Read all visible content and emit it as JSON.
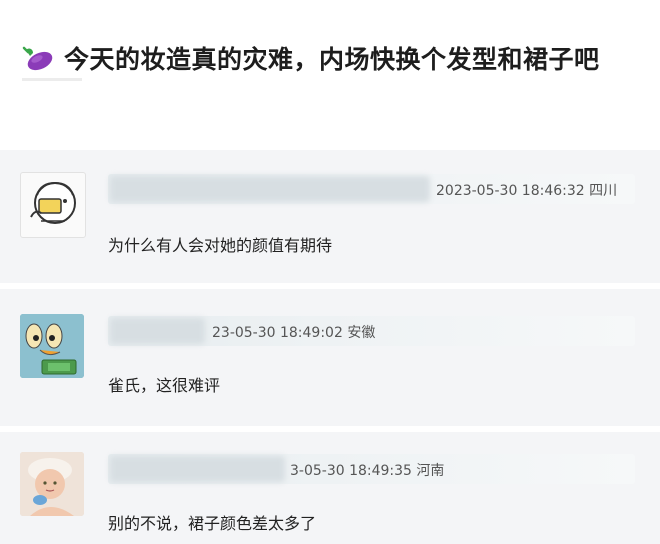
{
  "post": {
    "title": "今天的妆造真的灾难，内场快换个发型和裙子吧",
    "icon": "eggplant-icon"
  },
  "comments": [
    {
      "time_location": "2023-05-30 18:46:32 四川",
      "text": "为什么有人会对她的颜值有期待",
      "avatar": "cartoon-avatar-icon"
    },
    {
      "time_location": "23-05-30 18:49:02 安徽",
      "text": "雀氏，这很难评",
      "avatar": "cartoon-duck-avatar-icon"
    },
    {
      "time_location": "3-05-30 18:49:35 河南",
      "text": "别的不说，裙子颜色差太多了",
      "avatar": "baby-photo-avatar-icon"
    }
  ]
}
